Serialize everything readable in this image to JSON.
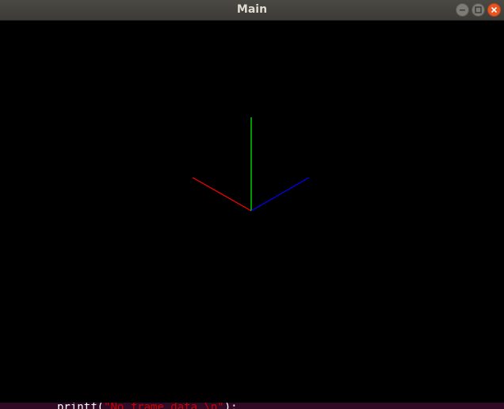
{
  "window": {
    "title": "Main",
    "controls": {
      "minimize_icon": "minimize-icon",
      "maximize_icon": "maximize-icon",
      "close_icon": "close-icon"
    }
  },
  "viewport": {
    "background": "#000000",
    "axes": [
      {
        "name": "x-axis",
        "color": "#ff0000"
      },
      {
        "name": "y-axis",
        "color": "#00ff00"
      },
      {
        "name": "z-axis",
        "color": "#0000ff"
      }
    ]
  },
  "terminal": {
    "code_prefix": "printf(",
    "code_string": "\"No frame data.\\n\"",
    "code_suffix": ");"
  }
}
